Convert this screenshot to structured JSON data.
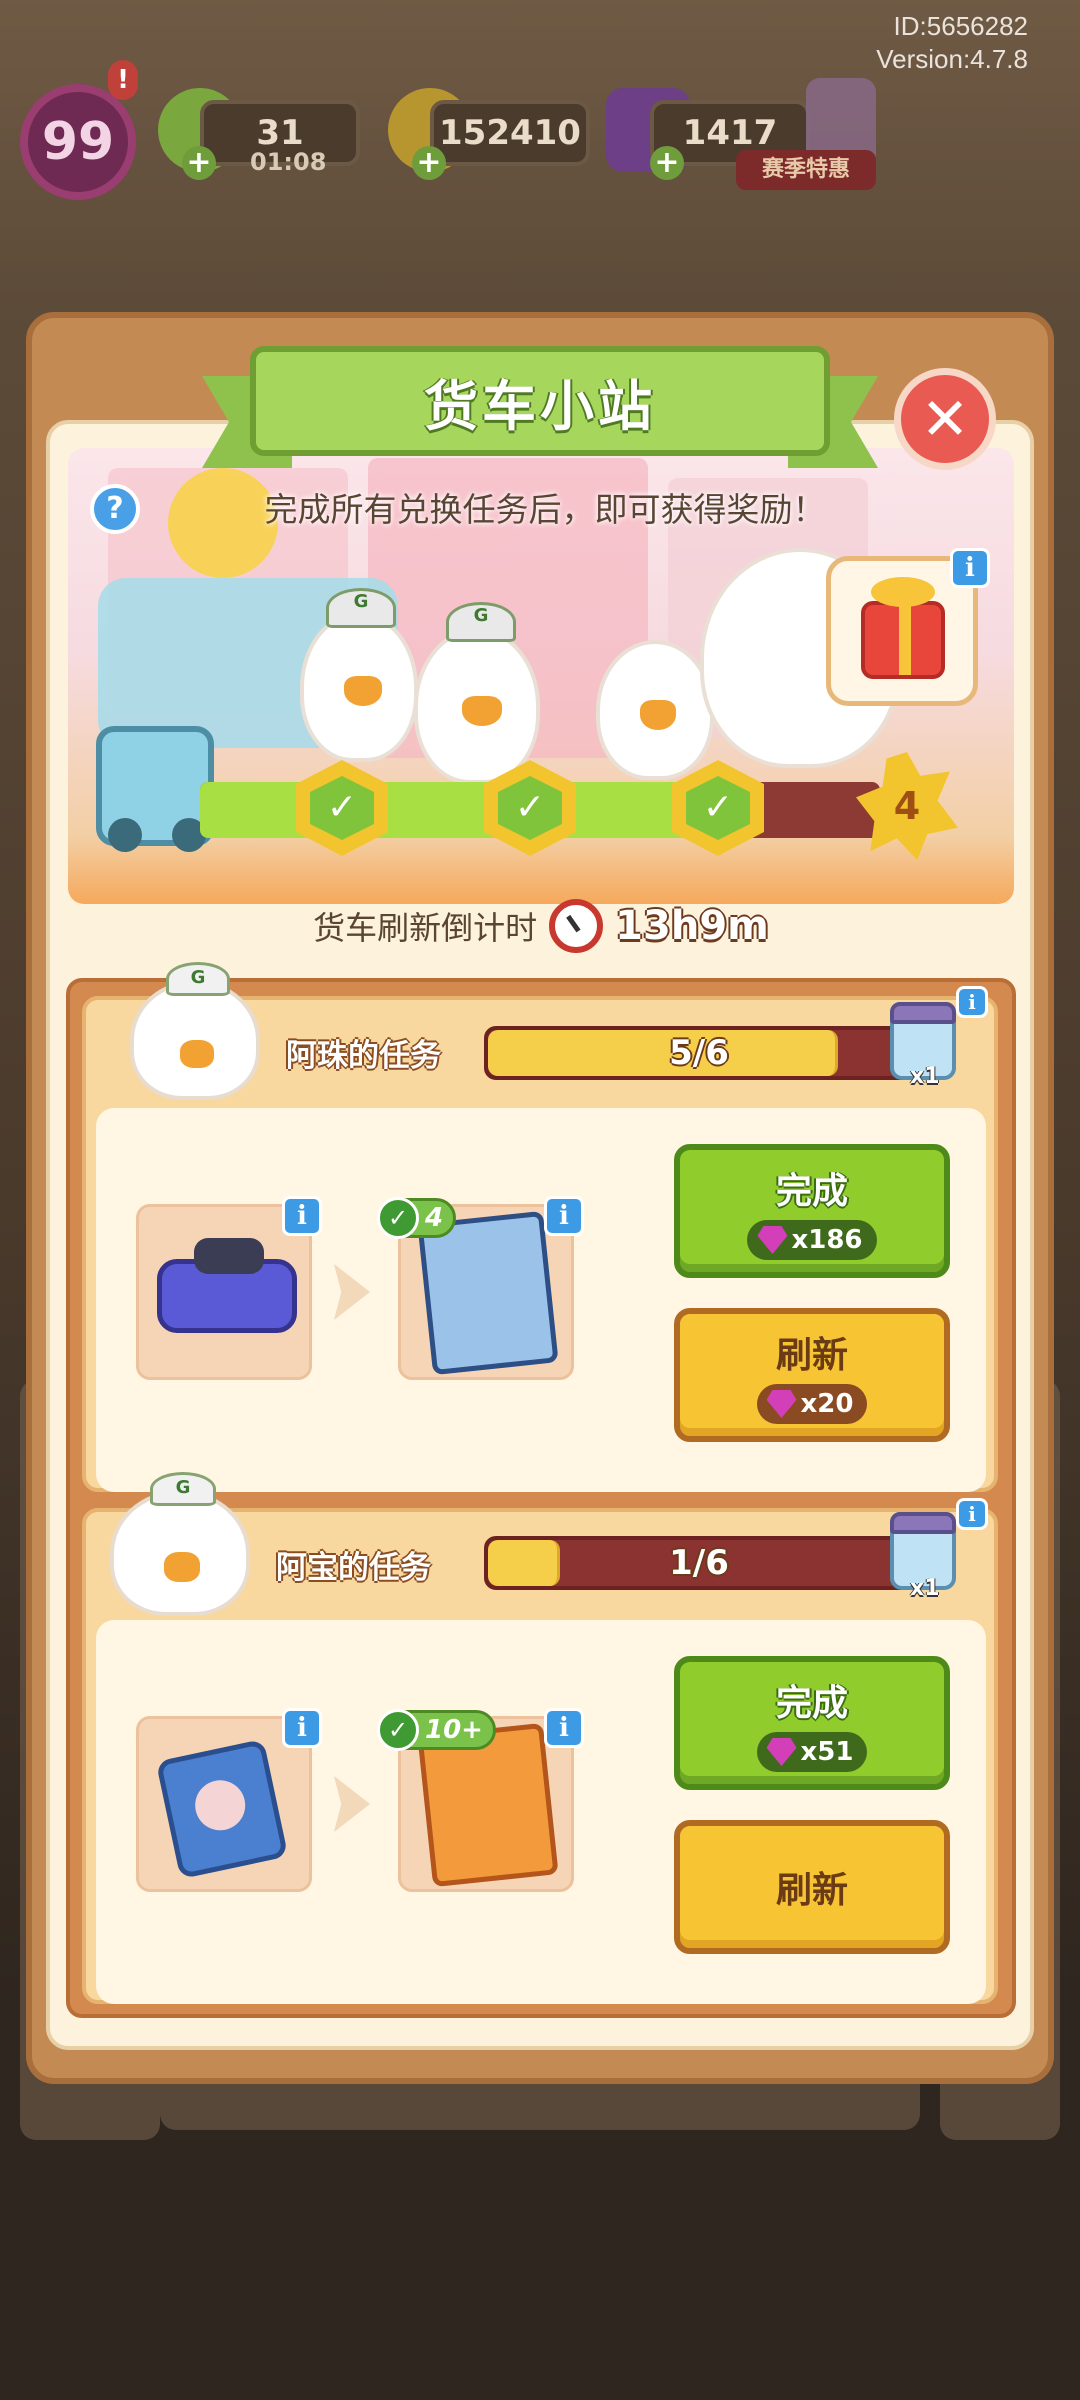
{
  "meta": {
    "id_text": "ID:5656282",
    "version_text": "Version:4.7.8"
  },
  "topbar": {
    "level": "99",
    "level_alert": "!",
    "energy": {
      "value": "31",
      "timer": "01:08",
      "icon": "lightning-icon"
    },
    "coins": {
      "value": "152410",
      "icon": "coin-icon"
    },
    "gems": {
      "value": "1417",
      "icon": "gem-icon"
    },
    "season": {
      "label": "赛季特惠",
      "icon": "season-offer-icon"
    }
  },
  "modal": {
    "title": "货车小站",
    "close_label": "✕",
    "hint": "完成所有兑换任务后，即可获得奖励！",
    "help_label": "?",
    "info_label": "i",
    "milestones": {
      "completed": 3,
      "total": 4,
      "final_label": "4"
    },
    "countdown_label": "货车刷新倒计时",
    "countdown_value": "13h9m"
  },
  "tasks": [
    {
      "owner": "阿珠的任务",
      "progress_text": "5/6",
      "progress": 0.83,
      "reward_count": "x1",
      "from_item": "game-console-icon",
      "to_item": "blue-book-icon",
      "to_owned": "4",
      "complete_label": "完成",
      "complete_cost": "x186",
      "refresh_label": "刷新",
      "refresh_cost": "x20"
    },
    {
      "owner": "阿宝的任务",
      "progress_text": "1/6",
      "progress": 0.17,
      "reward_count": "x1",
      "from_item": "cassette-player-icon",
      "to_item": "orange-book-icon",
      "to_owned": "10+",
      "complete_label": "完成",
      "complete_cost": "x51",
      "refresh_label": "刷新"
    }
  ],
  "colors": {
    "accent_green": "#8fcc2c",
    "accent_yellow": "#f7c534",
    "progress_track": "#8a3330",
    "gem": "#d23fb8",
    "panel": "#c48a54"
  }
}
